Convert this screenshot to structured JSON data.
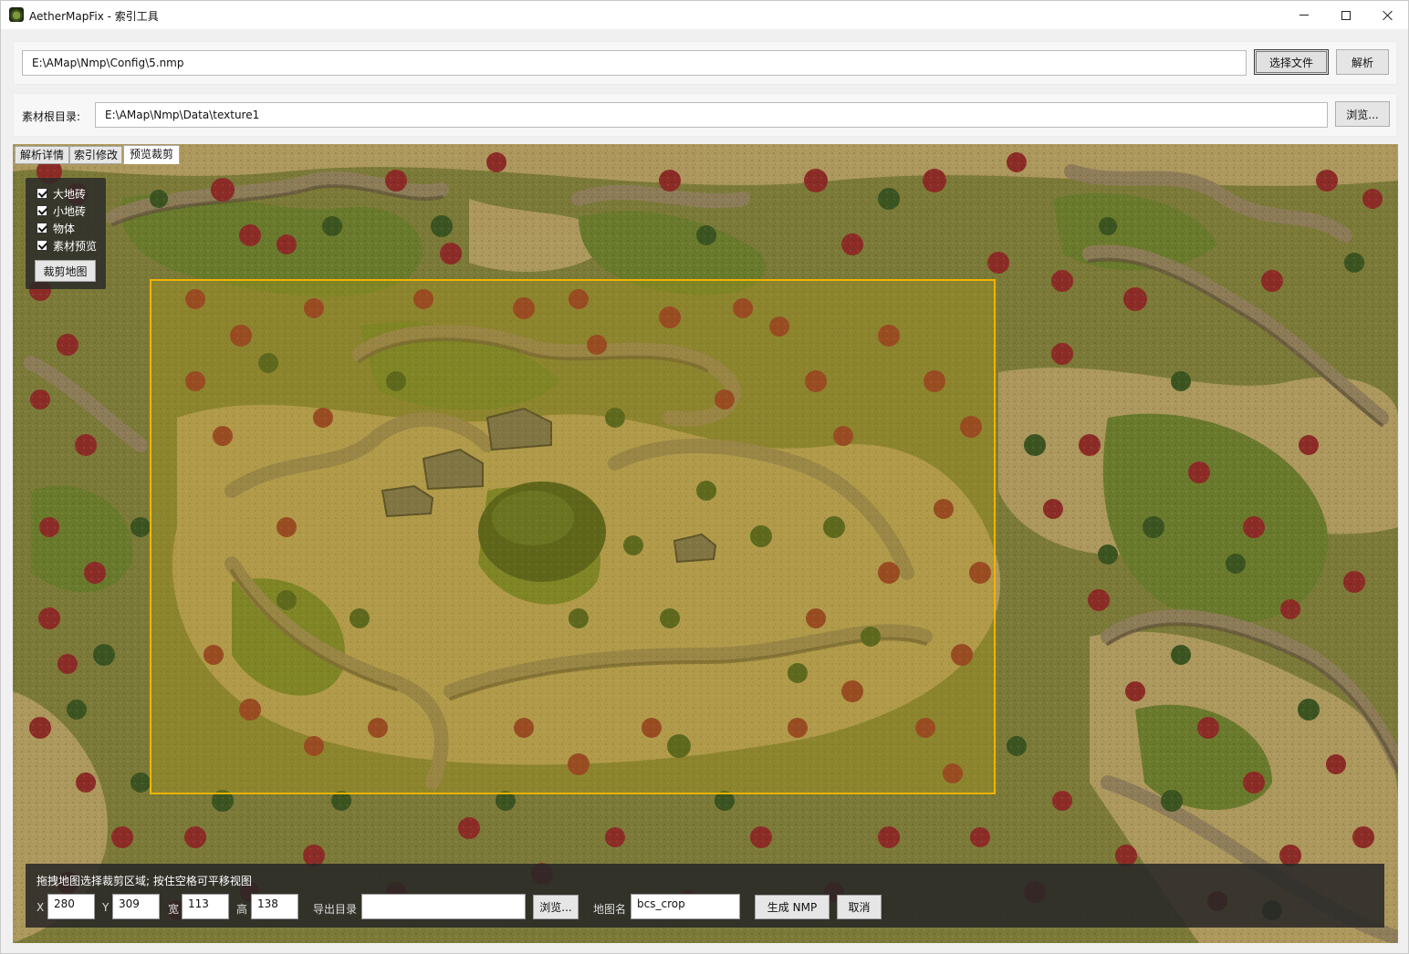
{
  "window": {
    "title": "AetherMapFix - 索引工具"
  },
  "file_row": {
    "path": "E:\\AMap\\Nmp\\Config\\5.nmp",
    "select_button": "选择文件",
    "parse_button": "解析"
  },
  "texture_row": {
    "label": "素材根目录:",
    "path": "E:\\AMap\\Nmp\\Data\\texture1",
    "browse_button": "浏览..."
  },
  "tabs": [
    {
      "label": "解析详情",
      "active": false
    },
    {
      "label": "索引修改",
      "active": false
    },
    {
      "label": "预览裁剪",
      "active": true
    }
  ],
  "layers": {
    "items": [
      {
        "label": "大地砖",
        "checked": true
      },
      {
        "label": "小地砖",
        "checked": true
      },
      {
        "label": "物体",
        "checked": true
      },
      {
        "label": "素材预览",
        "checked": true
      }
    ],
    "crop_button": "裁剪地图"
  },
  "crop_bar": {
    "hint": "拖拽地图选择裁剪区域; 按住空格可平移视图",
    "x_label": "X",
    "x_value": "280",
    "y_label": "Y",
    "y_value": "309",
    "w_label": "宽",
    "w_value": "113",
    "h_label": "高",
    "h_value": "138",
    "export_label": "导出目录",
    "export_value": "",
    "browse_button": "浏览...",
    "mapname_label": "地图名",
    "mapname_value": "bcs_crop",
    "generate_button": "生成 NMP",
    "cancel_button": "取消"
  },
  "colors": {
    "crop_border": "#f0b400",
    "grass": "#6f7d2e",
    "sand": "#b59a5a",
    "rock": "#8a7a5c",
    "red_tree": "#8a2a24",
    "green_tree": "#3f5a22"
  },
  "icons": {
    "app": "map-app-icon",
    "minimize": "minimize-icon",
    "maximize": "maximize-icon",
    "close": "close-icon"
  }
}
